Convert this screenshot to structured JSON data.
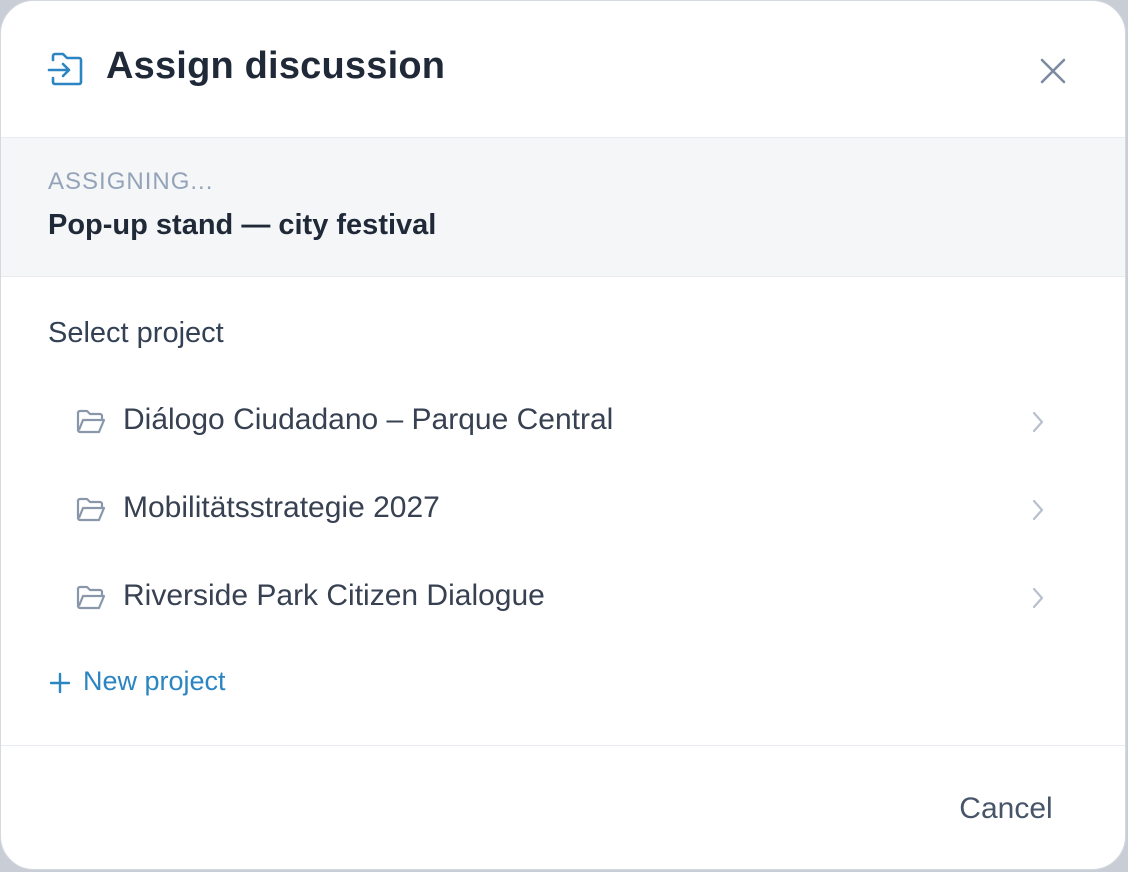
{
  "dialog": {
    "title": "Assign discussion",
    "title_icon": "assign-arrow-icon",
    "close_icon": "close-icon"
  },
  "assigning": {
    "label": "ASSIGNING...",
    "item_name": "Pop-up stand — city festival"
  },
  "select": {
    "label": "Select project",
    "projects": [
      {
        "name": "Diálogo Ciudadano – Parque Central",
        "icon": "folder-open-icon"
      },
      {
        "name": "Mobilitätsstrategie 2027",
        "icon": "folder-open-icon"
      },
      {
        "name": "Riverside Park Citizen Dialogue",
        "icon": "folder-open-icon"
      }
    ],
    "new_project_label": "New project"
  },
  "footer": {
    "cancel_label": "Cancel"
  },
  "colors": {
    "accent": "#2b85c2",
    "text_primary": "#1f2937",
    "text_muted": "#94a3b8",
    "section_bg": "#f4f6f8"
  }
}
